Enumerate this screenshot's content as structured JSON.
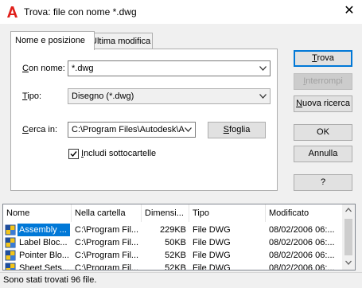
{
  "window": {
    "title": "Trova: file con nome *.dwg",
    "close_glyph": "✕"
  },
  "tabs": [
    {
      "label": "Nome e posizione",
      "active": true
    },
    {
      "label": "Ultima modifica",
      "active": false
    }
  ],
  "form": {
    "name_label_first": "C",
    "name_label_rest": "on nome:",
    "name_value": "*.dwg",
    "type_label_first": "T",
    "type_label_rest": "ipo:",
    "type_value": "Disegno (*.dwg)",
    "lookin_label_first": "C",
    "lookin_label_rest": "erca in:",
    "lookin_value": "C:\\Program Files\\Autodesk\\A",
    "browse_first": "S",
    "browse_rest": "foglia",
    "include_first": "I",
    "include_rest": "ncludi sottocartelle",
    "include_checked": true
  },
  "buttons": {
    "find_first": "T",
    "find_rest": "rova",
    "stop_first": "I",
    "stop_rest": "nterrompi",
    "new_first": "N",
    "new_rest": "uova ricerca",
    "ok": "OK",
    "cancel": "Annulla",
    "help": "?"
  },
  "results": {
    "headers": {
      "name": "Nome",
      "folder": "Nella cartella",
      "size": "Dimensi...",
      "type": "Tipo",
      "modified": "Modificato"
    },
    "rows": [
      {
        "name": "Assembly ...",
        "folder": "C:\\Program Fil...",
        "size": "229KB",
        "type": "File DWG",
        "modified": "08/02/2006 06:...",
        "selected": true
      },
      {
        "name": "Label Bloc...",
        "folder": "C:\\Program Fil...",
        "size": "50KB",
        "type": "File DWG",
        "modified": "08/02/2006 06:...",
        "selected": false
      },
      {
        "name": "Pointer Blo...",
        "folder": "C:\\Program Fil...",
        "size": "52KB",
        "type": "File DWG",
        "modified": "08/02/2006 06:...",
        "selected": false
      },
      {
        "name": "Sheet Sets...",
        "folder": "C:\\Program Fil...",
        "size": "52KB",
        "type": "File DWG",
        "modified": "08/02/2006 06:...",
        "selected": false
      }
    ]
  },
  "status": "Sono stati trovati 96 file.",
  "colors": {
    "accent": "#0078d7",
    "selection": "#0078d7",
    "app_icon": "#e0201b"
  },
  "icons": {
    "app": "autocad-a-icon",
    "dropdown": "chevron-down-icon",
    "file": "dwg-file-icon"
  }
}
